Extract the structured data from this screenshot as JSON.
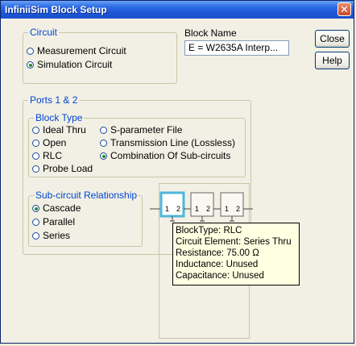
{
  "window": {
    "title": "InfiniiSim Block Setup",
    "close_glyph": "✕"
  },
  "circuit": {
    "legend": "Circuit",
    "options": [
      {
        "label": "Measurement Circuit",
        "selected": false
      },
      {
        "label": "Simulation Circuit",
        "selected": true
      }
    ]
  },
  "block_name": {
    "label": "Block Name",
    "value": "E = W2635A Interp..."
  },
  "buttons": {
    "close": "Close",
    "help": "Help"
  },
  "ports": {
    "legend": "Ports 1 & 2",
    "block_type": {
      "legend": "Block Type",
      "options": [
        {
          "label": "Ideal Thru",
          "selected": false
        },
        {
          "label": "S-parameter File",
          "selected": false
        },
        {
          "label": "Open",
          "selected": false
        },
        {
          "label": "Transmission Line (Lossless)",
          "selected": false
        },
        {
          "label": "RLC",
          "selected": false
        },
        {
          "label": "Combination Of Sub-circuits",
          "selected": true
        },
        {
          "label": "Probe Load",
          "selected": false
        }
      ]
    },
    "relationship": {
      "legend": "Sub-circuit Relationship",
      "options": [
        {
          "label": "Cascade",
          "selected": true
        },
        {
          "label": "Parallel",
          "selected": false
        },
        {
          "label": "Series",
          "selected": false
        }
      ]
    }
  },
  "diagram": {
    "blocks": [
      {
        "port1": "1",
        "port2": "2",
        "selected": true
      },
      {
        "port1": "1",
        "port2": "2",
        "selected": false
      },
      {
        "port1": "1",
        "port2": "2",
        "selected": false
      }
    ]
  },
  "tooltip": {
    "lines": [
      "BlockType: RLC",
      "Circuit Element: Series Thru",
      "Resistance: 75.00 Ω",
      "Inductance: Unused",
      "Capacitance: Unused"
    ]
  },
  "colors": {
    "title_bar": "#1c56d8",
    "group_legend": "#0046d5",
    "selection": "#4fb6dc",
    "tooltip_bg": "#ffffe1"
  }
}
